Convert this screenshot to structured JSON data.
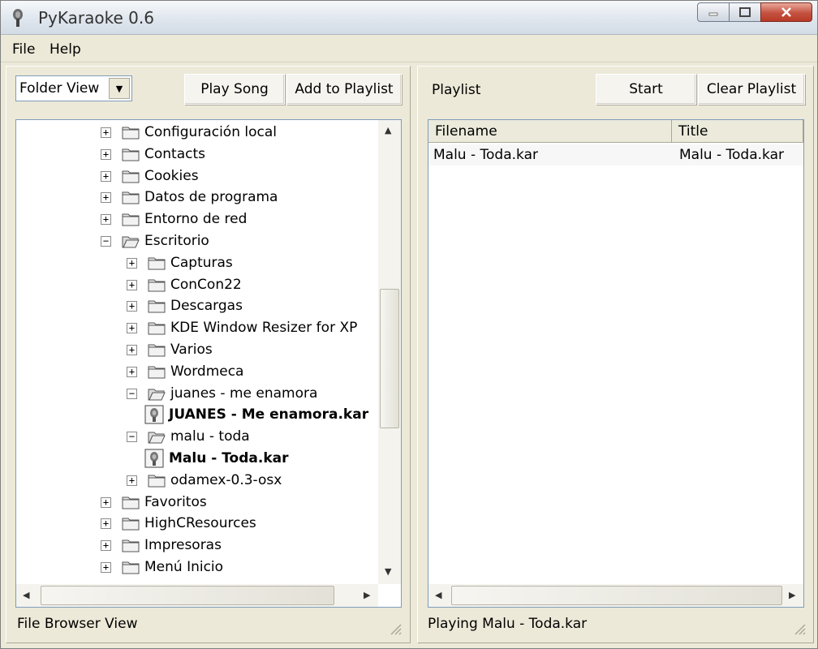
{
  "window": {
    "title": "PyKaraoke 0.6"
  },
  "menu": {
    "items": [
      "File",
      "Help"
    ]
  },
  "left": {
    "view_select": "Folder View",
    "play_button": "Play Song",
    "add_button": "Add to Playlist",
    "tree": [
      {
        "label": "Configuración local",
        "depth": 0,
        "type": "folder",
        "expanded": false
      },
      {
        "label": "Contacts",
        "depth": 0,
        "type": "folder",
        "expanded": false
      },
      {
        "label": "Cookies",
        "depth": 0,
        "type": "folder",
        "expanded": false
      },
      {
        "label": "Datos de programa",
        "depth": 0,
        "type": "folder",
        "expanded": false
      },
      {
        "label": "Entorno de red",
        "depth": 0,
        "type": "folder",
        "expanded": false
      },
      {
        "label": "Escritorio",
        "depth": 0,
        "type": "folder",
        "expanded": true
      },
      {
        "label": "Capturas",
        "depth": 1,
        "type": "folder",
        "expanded": false
      },
      {
        "label": "ConCon22",
        "depth": 1,
        "type": "folder",
        "expanded": false
      },
      {
        "label": "Descargas",
        "depth": 1,
        "type": "folder",
        "expanded": false
      },
      {
        "label": "KDE Window Resizer for XP",
        "depth": 1,
        "type": "folder",
        "expanded": false
      },
      {
        "label": "Varios",
        "depth": 1,
        "type": "folder",
        "expanded": false
      },
      {
        "label": "Wordmeca",
        "depth": 1,
        "type": "folder",
        "expanded": false
      },
      {
        "label": "juanes - me enamora",
        "depth": 1,
        "type": "folder",
        "expanded": true
      },
      {
        "label": "JUANES - Me enamora.kar",
        "depth": 2,
        "type": "file"
      },
      {
        "label": "malu - toda",
        "depth": 1,
        "type": "folder",
        "expanded": true
      },
      {
        "label": "Malu - Toda.kar",
        "depth": 2,
        "type": "file"
      },
      {
        "label": "odamex-0.3-osx",
        "depth": 1,
        "type": "folder",
        "expanded": false
      },
      {
        "label": "Favoritos",
        "depth": 0,
        "type": "folder",
        "expanded": false
      },
      {
        "label": "HighCResources",
        "depth": 0,
        "type": "folder",
        "expanded": false
      },
      {
        "label": "Impresoras",
        "depth": 0,
        "type": "folder",
        "expanded": false
      },
      {
        "label": "Menú Inicio",
        "depth": 0,
        "type": "folder",
        "expanded": false
      }
    ],
    "status": "File Browser View"
  },
  "right": {
    "title": "Playlist",
    "start_button": "Start",
    "clear_button": "Clear Playlist",
    "columns": [
      "Filename",
      "Title"
    ],
    "rows": [
      {
        "filename": "Malu - Toda.kar",
        "title": "Malu - Toda.kar"
      }
    ],
    "status": "Playing Malu - Toda.kar"
  }
}
